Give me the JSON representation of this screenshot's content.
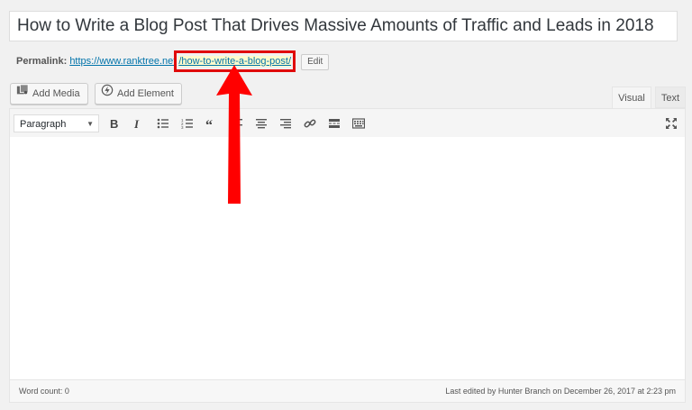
{
  "post": {
    "title": "How to Write a Blog Post That Drives Massive Amounts of Traffic and Leads in 2018"
  },
  "permalink": {
    "label": "Permalink:",
    "base_url": "https://www.ranktree.net",
    "slug": "/how-to-write-a-blog-post/",
    "edit_label": "Edit"
  },
  "media": {
    "add_media_label": "Add Media",
    "add_element_label": "Add Element"
  },
  "tabs": {
    "visual": "Visual",
    "text": "Text"
  },
  "toolbar": {
    "format_value": "Paragraph",
    "icons": [
      "bold-icon",
      "italic-icon",
      "bulleted-list-icon",
      "numbered-list-icon",
      "blockquote-icon",
      "align-left-icon",
      "align-center-icon",
      "align-right-icon",
      "link-icon",
      "read-more-icon",
      "toolbar-toggle-icon",
      "fullscreen-icon"
    ]
  },
  "status": {
    "word_count": "Word count: 0",
    "last_edited": "Last edited by Hunter Branch on December 26, 2017 at 2:23 pm"
  },
  "colors": {
    "highlight_border": "#e00a0a",
    "link": "#0073aa",
    "annotation_arrow": "#ff0000"
  }
}
